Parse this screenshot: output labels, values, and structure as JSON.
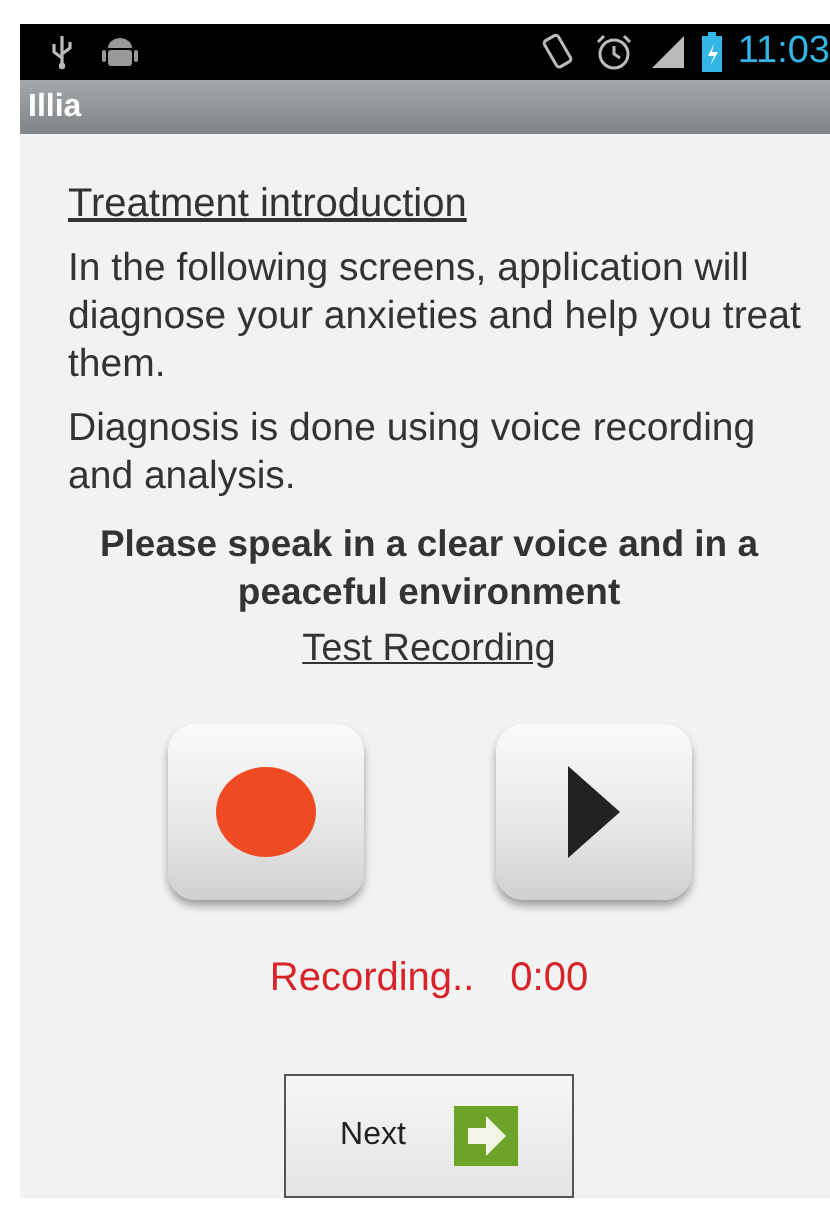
{
  "status_bar": {
    "time": "11:03"
  },
  "action_bar": {
    "title": "Illia"
  },
  "heading": "Treatment introduction",
  "paragraphs": [
    "In the following screens, application will diagnose your anxieties and help you treat them.",
    "Diagnosis is done using voice recording and analysis."
  ],
  "instruction": "Please speak in a clear voice and in a peaceful environment",
  "test_link": "Test Recording",
  "recording": {
    "status": "Recording..",
    "time": "0:00"
  },
  "next_button": {
    "label": "Next"
  }
}
